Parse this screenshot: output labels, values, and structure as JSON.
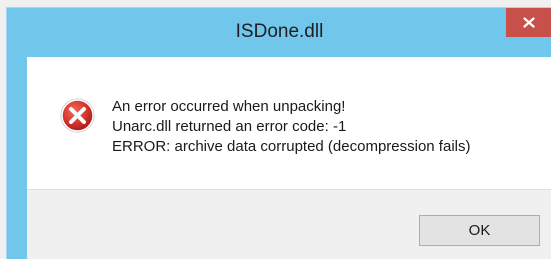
{
  "window": {
    "title": "ISDone.dll",
    "close_label": "x"
  },
  "dialog": {
    "icon": "error-icon",
    "lines": [
      "An error occurred when unpacking!",
      "Unarc.dll returned an error code: -1",
      "ERROR: archive data corrupted (decompression fails)"
    ],
    "ok_label": "OK"
  },
  "colors": {
    "titlebar": "#71c6ec",
    "close_button": "#c7504a",
    "error_red": "#d03030",
    "content_bg": "#ffffff",
    "footer_bg": "#f0f0f0"
  }
}
